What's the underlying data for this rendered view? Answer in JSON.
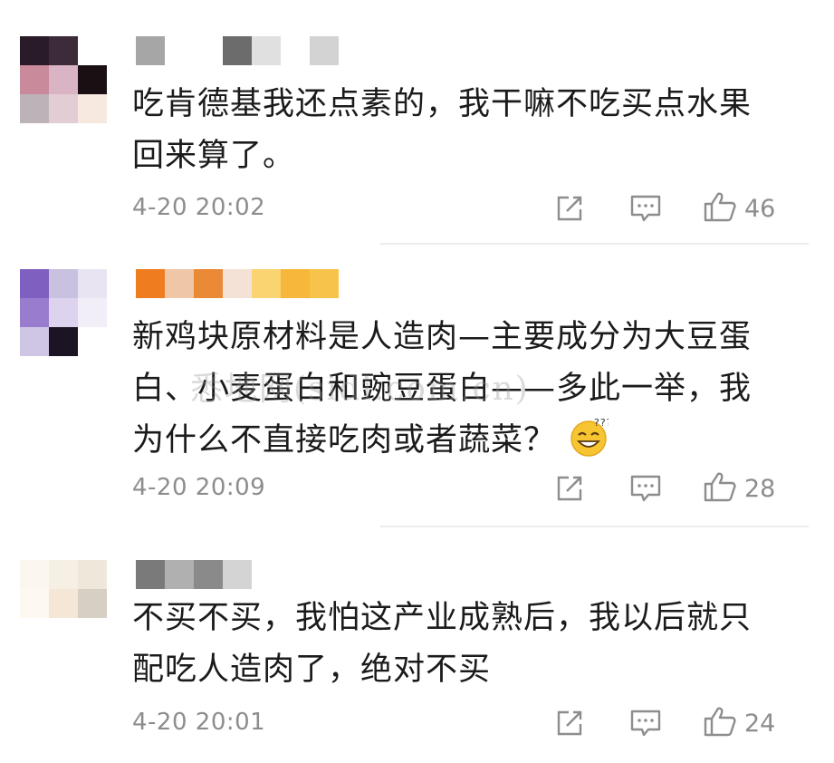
{
  "watermark": "悉地网(sidi.com.cn)",
  "comments": [
    {
      "text_lines": [
        "吃肯德基我还点素的，我干嘛不吃买点水果",
        "回来算了。"
      ],
      "time": "4-20 20:02",
      "likes": "46",
      "avatar_colors": [
        "#2a1b28",
        "#3d2b3a",
        "#ffffff",
        "#c98a9b",
        "#d9b4c4",
        "#1a1014",
        "#bcb2b8",
        "#e2cdd4",
        "#f7e8e0"
      ],
      "username_colors": [
        "#a6a6a6",
        "#ffffff",
        "#ffffff",
        "#6c6c6c",
        "#e0e0e0",
        "#ffffff",
        "#d3d3d3"
      ]
    },
    {
      "text_lines": [
        "新鸡块原材料是人造肉—主要成分为大豆蛋",
        "白、小麦蛋白和豌豆蛋白——多此一举，我",
        "为什么不直接吃肉或者蔬菜？"
      ],
      "time": "4-20 20:09",
      "likes": "28",
      "avatar_colors": [
        "#7f5fbf",
        "#c9c1e0",
        "#e8e4f2",
        "#9a7ccf",
        "#ddd3ee",
        "#f2eef8",
        "#cfc6e6",
        "#1c1424",
        "#ffffff"
      ],
      "username_colors": [
        "#ef7d1f",
        "#efc7a6",
        "#ea8a36",
        "#f4e2d6",
        "#f9d470",
        "#f6b73a",
        "#f7c34a"
      ]
    },
    {
      "text_lines": [
        "不买不买，我怕这产业成熟后，我以后就只",
        "配吃人造肉了，绝对不买"
      ],
      "time": "4-20 20:01",
      "likes": "24",
      "avatar_colors": [
        "#fbf7ef",
        "#f6efe3",
        "#efe7da",
        "#fdf8f0",
        "#f4e7d6",
        "#d6cfc4",
        "#ffffff",
        "#ffffff",
        "#ffffff"
      ],
      "username_colors": [
        "#7a7a7a",
        "#b0b0b0",
        "#8a8a8a",
        "#d4d4d4"
      ]
    }
  ],
  "icons": {
    "share": "share-icon",
    "comment": "comment-icon",
    "like": "thumbs-up-icon"
  }
}
